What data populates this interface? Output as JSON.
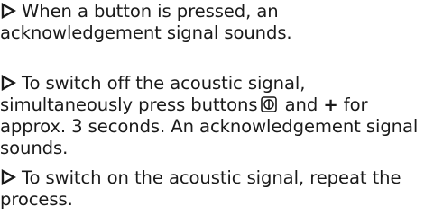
{
  "paragraphs": [
    {
      "lines": [
        "When a button is pressed, an",
        "acknowledgement signal sounds."
      ]
    },
    {
      "lines_a": [
        "To switch off the acoustic signal,",
        "simultaneously press buttons"
      ],
      "mid": "and",
      "plus": "+",
      "tail": "for",
      "lines_b": [
        "approx. 3 seconds. An acknowledgement signal",
        "sounds."
      ]
    },
    {
      "lines": [
        "To switch on the acoustic signal, repeat the",
        "process."
      ]
    }
  ],
  "icons": {
    "bullet": "right-triangle-outline-icon",
    "button": "power-button-icon"
  }
}
